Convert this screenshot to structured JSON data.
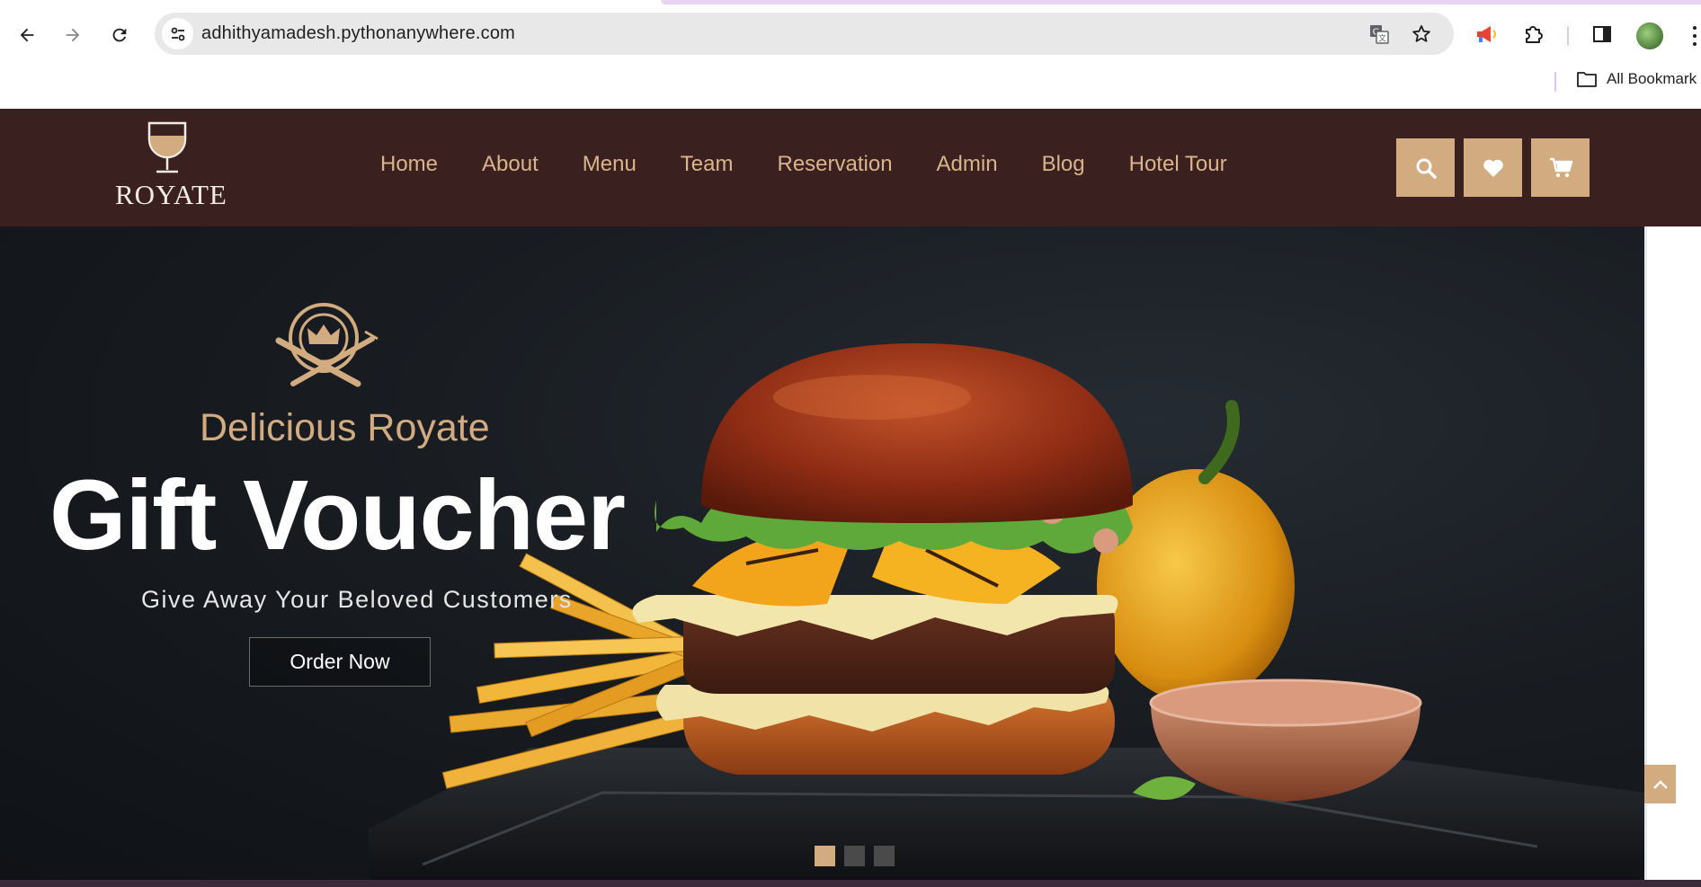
{
  "browser": {
    "url": "adhithyamadesh.pythonanywhere.com",
    "bookmarks_label": "All Bookmark"
  },
  "site": {
    "brand": "ROYATE",
    "nav": [
      "Home",
      "About",
      "Menu",
      "Team",
      "Reservation",
      "Admin",
      "Blog",
      "Hotel Tour"
    ]
  },
  "hero": {
    "kicker": "Delicious Royate",
    "headline": "Gift Voucher",
    "subline": "Give Away Your Beloved Customers",
    "cta": "Order Now",
    "slides": 3,
    "active_slide": 1
  },
  "colors": {
    "header_bg": "#3a2120",
    "accent": "#d3ab80",
    "nav_text": "#d9b48c"
  },
  "icons": [
    "back-arrow-icon",
    "forward-arrow-icon",
    "reload-icon",
    "site-info-icon",
    "translate-icon",
    "star-icon",
    "megaphone-icon",
    "extensions-icon",
    "side-panel-icon",
    "folder-icon",
    "search-icon",
    "heart-icon",
    "cart-icon",
    "chevron-up-icon"
  ]
}
